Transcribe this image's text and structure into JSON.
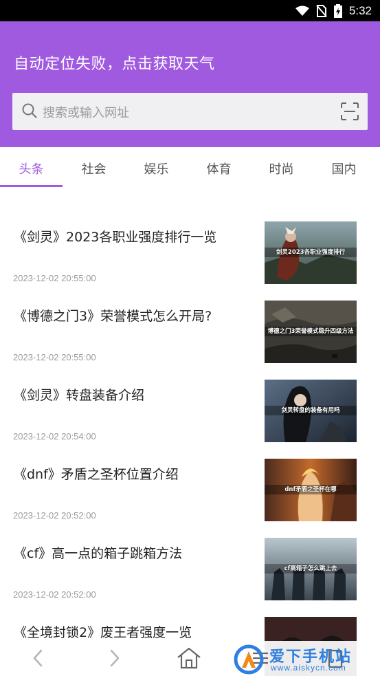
{
  "status_bar": {
    "time": "5:32"
  },
  "header": {
    "weather_text": "自动定位失败，点击获取天气",
    "search_placeholder": "搜索或输入网址"
  },
  "tabs": [
    {
      "label": "头条",
      "active": true
    },
    {
      "label": "社会"
    },
    {
      "label": "娱乐"
    },
    {
      "label": "体育"
    },
    {
      "label": "时尚"
    },
    {
      "label": "国内"
    }
  ],
  "news": [
    {
      "title": "《剑灵》2023各职业强度排行一览",
      "date": "2023-12-02 20:55:00",
      "thumb_caption": "剑灵2023各职业强度排行"
    },
    {
      "title": "《博德之门3》荣誉模式怎么开局?",
      "date": "2023-12-02 20:55:00",
      "thumb_caption": "博德之门3荣誉模式稳升四级方法"
    },
    {
      "title": "《剑灵》转盘装备介绍",
      "date": "2023-12-02 20:54:00",
      "thumb_caption": "剑灵转盘的装备有用吗"
    },
    {
      "title": "《dnf》矛盾之圣杯位置介绍",
      "date": "2023-12-02 20:52:00",
      "thumb_caption": "dnf矛盾之圣杯在哪"
    },
    {
      "title": "《cf》高一点的箱子跳箱方法",
      "date": "2023-12-02 20:52:00",
      "thumb_caption": "cf高箱子怎么跳上去"
    },
    {
      "title": "《全境封锁2》废王者强度一览",
      "date": "",
      "thumb_caption": ""
    }
  ],
  "watermark": {
    "text": "爱下手机站",
    "url": "www.aiskycn.com"
  },
  "colors": {
    "accent": "#a05ae0",
    "watermark": "#2d7fe0"
  }
}
